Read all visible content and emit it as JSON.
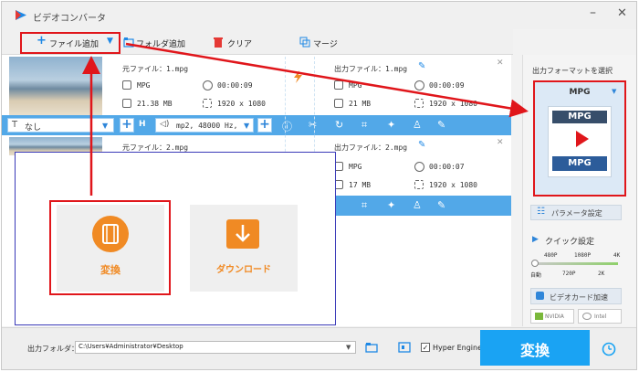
{
  "window": {
    "title": "ビデオコンバータ"
  },
  "toolbar": {
    "add_file": "ファイル追加",
    "add_folder": "フォルダ追加",
    "clear": "クリア",
    "merge": "マージ"
  },
  "items": [
    {
      "source_name": "元ファイル：1.mpg",
      "source_format": "MPG",
      "source_duration": "00:00:09",
      "source_size": "21.38 MB",
      "source_resolution": "1920 x 1080",
      "output_name": "出力ファイル：1.mpg",
      "output_format": "MPG",
      "output_duration": "00:00:09",
      "output_size": "21 MB",
      "output_resolution": "1920 x 1080"
    },
    {
      "source_name": "元ファイル：2.mpg",
      "output_name": "出力ファイル：2.mpg",
      "output_format": "MPG",
      "output_duration": "00:00:07",
      "output_size": "17 MB",
      "output_resolution": "1920 x 1080"
    }
  ],
  "edit_bar": {
    "subtitle_value": "なし",
    "audio_value": "mp2, 48000 Hz,"
  },
  "dialog": {
    "convert_label": "変換",
    "download_label": "ダウンロード"
  },
  "right_panel": {
    "output_format_label": "出力フォーマットを選択",
    "format_value": "MPG",
    "format_icon_top": "MPG",
    "format_icon_bottom": "MPG",
    "parameters_label": "パラメータ設定",
    "quick_settings_label": "クイック設定",
    "quality_top": [
      "480P",
      "1080P",
      "4K"
    ],
    "quality_bottom": [
      "自動",
      "720P",
      "2K"
    ],
    "gpu_label": "ビデオカード加速",
    "nvidia_label": "NVIDIA",
    "intel_label": "Intel"
  },
  "bottom": {
    "output_folder_label": "出力フォルダ：",
    "output_folder_path": "C:\\Users¥Administrator¥Desktop",
    "hyper_engine_label": "Hyper Engine",
    "convert_button": "変換"
  },
  "colors": {
    "accent_blue": "#1aa3f3",
    "edit_bar": "#52a8e8",
    "highlight_red": "#e0161b",
    "convert_orange": "#f08a24",
    "dialog_border": "#3a3ab8"
  }
}
